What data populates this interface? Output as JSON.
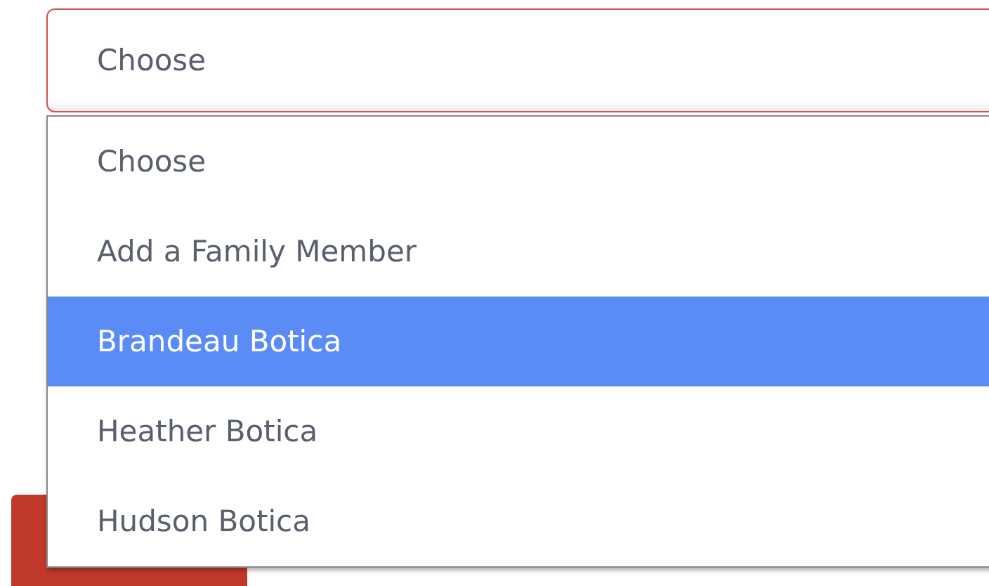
{
  "select": {
    "value": "Choose",
    "expanded": true,
    "options": [
      {
        "label": "Choose",
        "highlighted": false
      },
      {
        "label": "Add a Family Member",
        "highlighted": false
      },
      {
        "label": "Brandeau Botica",
        "highlighted": true
      },
      {
        "label": "Heather Botica",
        "highlighted": false
      },
      {
        "label": "Hudson Botica",
        "highlighted": false
      }
    ]
  }
}
